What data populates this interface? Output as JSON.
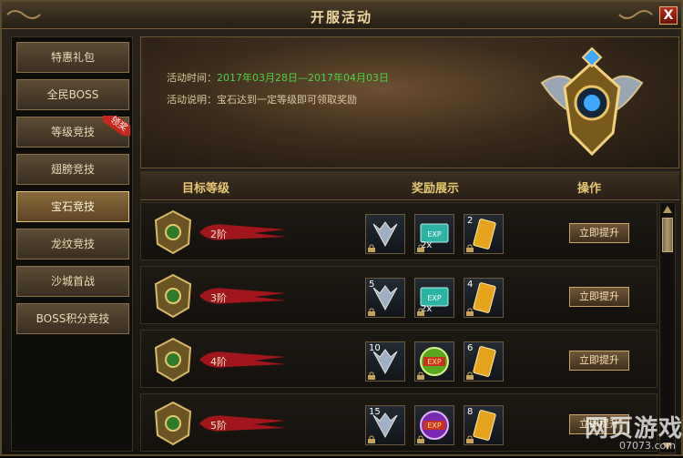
{
  "window": {
    "title": "开服活动",
    "close_label": "X"
  },
  "sidebar": {
    "items": [
      {
        "label": "特惠礼包",
        "active": false
      },
      {
        "label": "全民BOSS",
        "active": false
      },
      {
        "label": "等级竞技",
        "active": false,
        "badge": "领奖"
      },
      {
        "label": "翅膀竞技",
        "active": false
      },
      {
        "label": "宝石竞技",
        "active": true
      },
      {
        "label": "龙纹竞技",
        "active": false
      },
      {
        "label": "沙城首战",
        "active": false
      },
      {
        "label": "BOSS积分竞技",
        "active": false
      }
    ]
  },
  "banner": {
    "time_label": "活动时间：",
    "time_value": "2017年03月28日—2017年04月03日",
    "desc_label": "活动说明：",
    "desc_value": "宝石达到一定等级即可领取奖励"
  },
  "table": {
    "headers": {
      "level": "目标等级",
      "reward": "奖励展示",
      "action": "操作"
    },
    "rows": [
      {
        "level": "2阶",
        "rewards": [
          {
            "icon": "arrow-icon",
            "count": ""
          },
          {
            "icon": "exp-ticket-icon",
            "count": "2x"
          },
          {
            "icon": "gold-card-icon",
            "count": "2"
          }
        ],
        "button": "立即提升"
      },
      {
        "level": "3阶",
        "rewards": [
          {
            "icon": "arrow-icon",
            "count": "5"
          },
          {
            "icon": "exp-ticket-icon",
            "count": "2x"
          },
          {
            "icon": "gold-card-icon",
            "count": "4"
          }
        ],
        "button": "立即提升"
      },
      {
        "level": "4阶",
        "rewards": [
          {
            "icon": "arrow-icon",
            "count": "10"
          },
          {
            "icon": "exp-orb-icon",
            "count": ""
          },
          {
            "icon": "gold-card-icon",
            "count": "6"
          }
        ],
        "button": "立即提升"
      },
      {
        "level": "5阶",
        "rewards": [
          {
            "icon": "arrow-icon",
            "count": "15"
          },
          {
            "icon": "exp-purple-icon",
            "count": ""
          },
          {
            "icon": "gold-card-icon",
            "count": "8"
          }
        ],
        "button": "立即提升"
      }
    ]
  },
  "watermark": {
    "main": "网页游戏",
    "sub": "07073.com"
  },
  "colors": {
    "highlight_green": "#4fd14a",
    "header_gold": "#e6c873",
    "level_red": "#a0161a"
  }
}
